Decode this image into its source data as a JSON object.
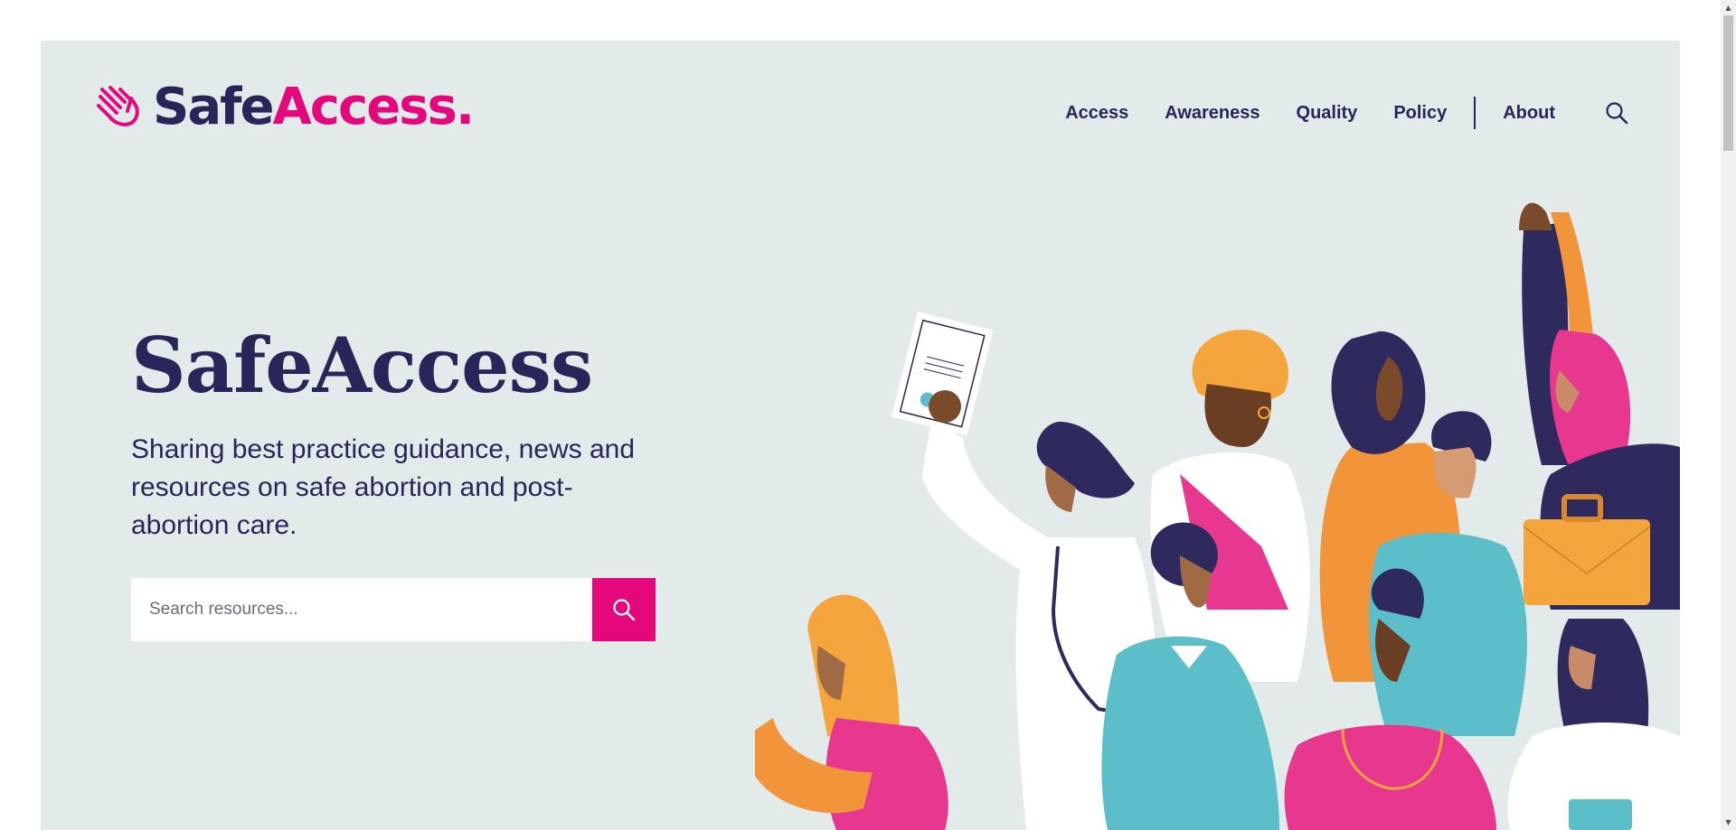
{
  "brand": {
    "name_part1": "Safe",
    "name_part2": "Access.",
    "primary_color": "#2a2558",
    "accent_color": "#e5087c",
    "background_color": "#e2eaea"
  },
  "nav": {
    "items": [
      {
        "label": "Access"
      },
      {
        "label": "Awareness"
      },
      {
        "label": "Quality"
      },
      {
        "label": "Policy"
      },
      {
        "label": "About"
      }
    ],
    "search_icon": "search-icon"
  },
  "hero": {
    "title": "SafeAccess",
    "subtitle": "Sharing best practice guidance, news and resources on safe abortion and post-abortion care."
  },
  "search": {
    "placeholder": "Search resources...",
    "value": "",
    "button_icon": "search-icon"
  }
}
